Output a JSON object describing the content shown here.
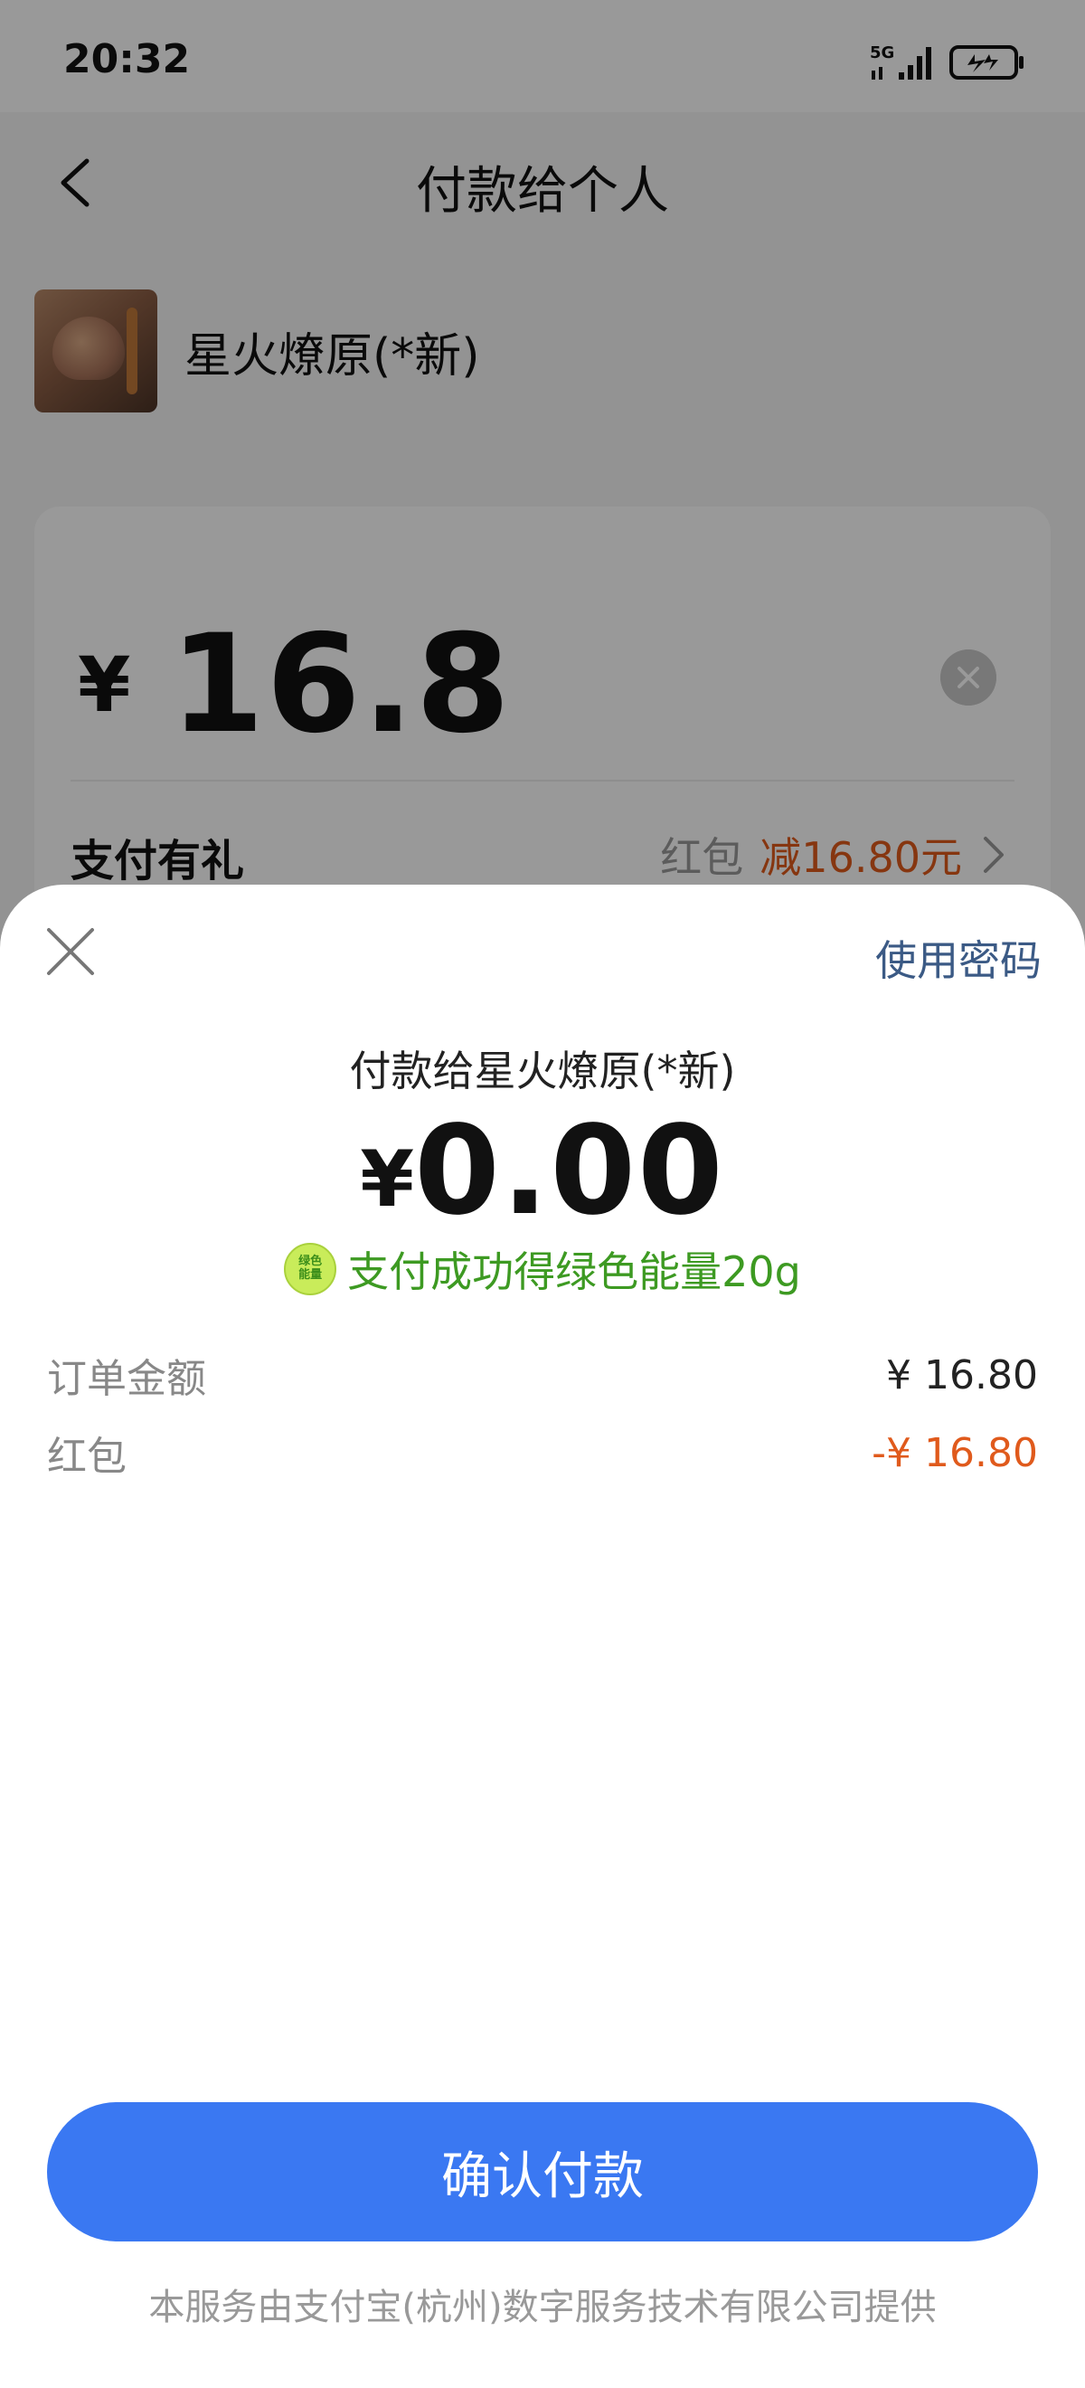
{
  "status_bar": {
    "time": "20:32",
    "network": "5G"
  },
  "header": {
    "title": "付款给个人"
  },
  "payee": {
    "name": "星火燎原(*新)"
  },
  "amount_card": {
    "currency_symbol": "¥",
    "amount": "16.8",
    "gift_label": "支付有礼",
    "gift_type": "红包",
    "gift_discount": "减16.80元"
  },
  "sheet": {
    "use_password_label": "使用密码",
    "payee_line": "付款给星火燎原(*新)",
    "currency_symbol": "¥",
    "pay_amount": "0.00",
    "energy_icon_text_1": "绿色",
    "energy_icon_text_2": "能量",
    "energy_text": "支付成功得绿色能量20g",
    "details": [
      {
        "label": "订单金额",
        "value": "¥ 16.80"
      },
      {
        "label": "红包",
        "value": "-¥ 16.80"
      }
    ],
    "confirm_label": "确认付款",
    "footer_note": "本服务由支付宝(杭州)数字服务技术有限公司提供"
  },
  "colors": {
    "primary_button": "#3a78f2",
    "discount": "#e05a1c",
    "energy_green": "#3d9a22",
    "link": "#3b5a85"
  }
}
